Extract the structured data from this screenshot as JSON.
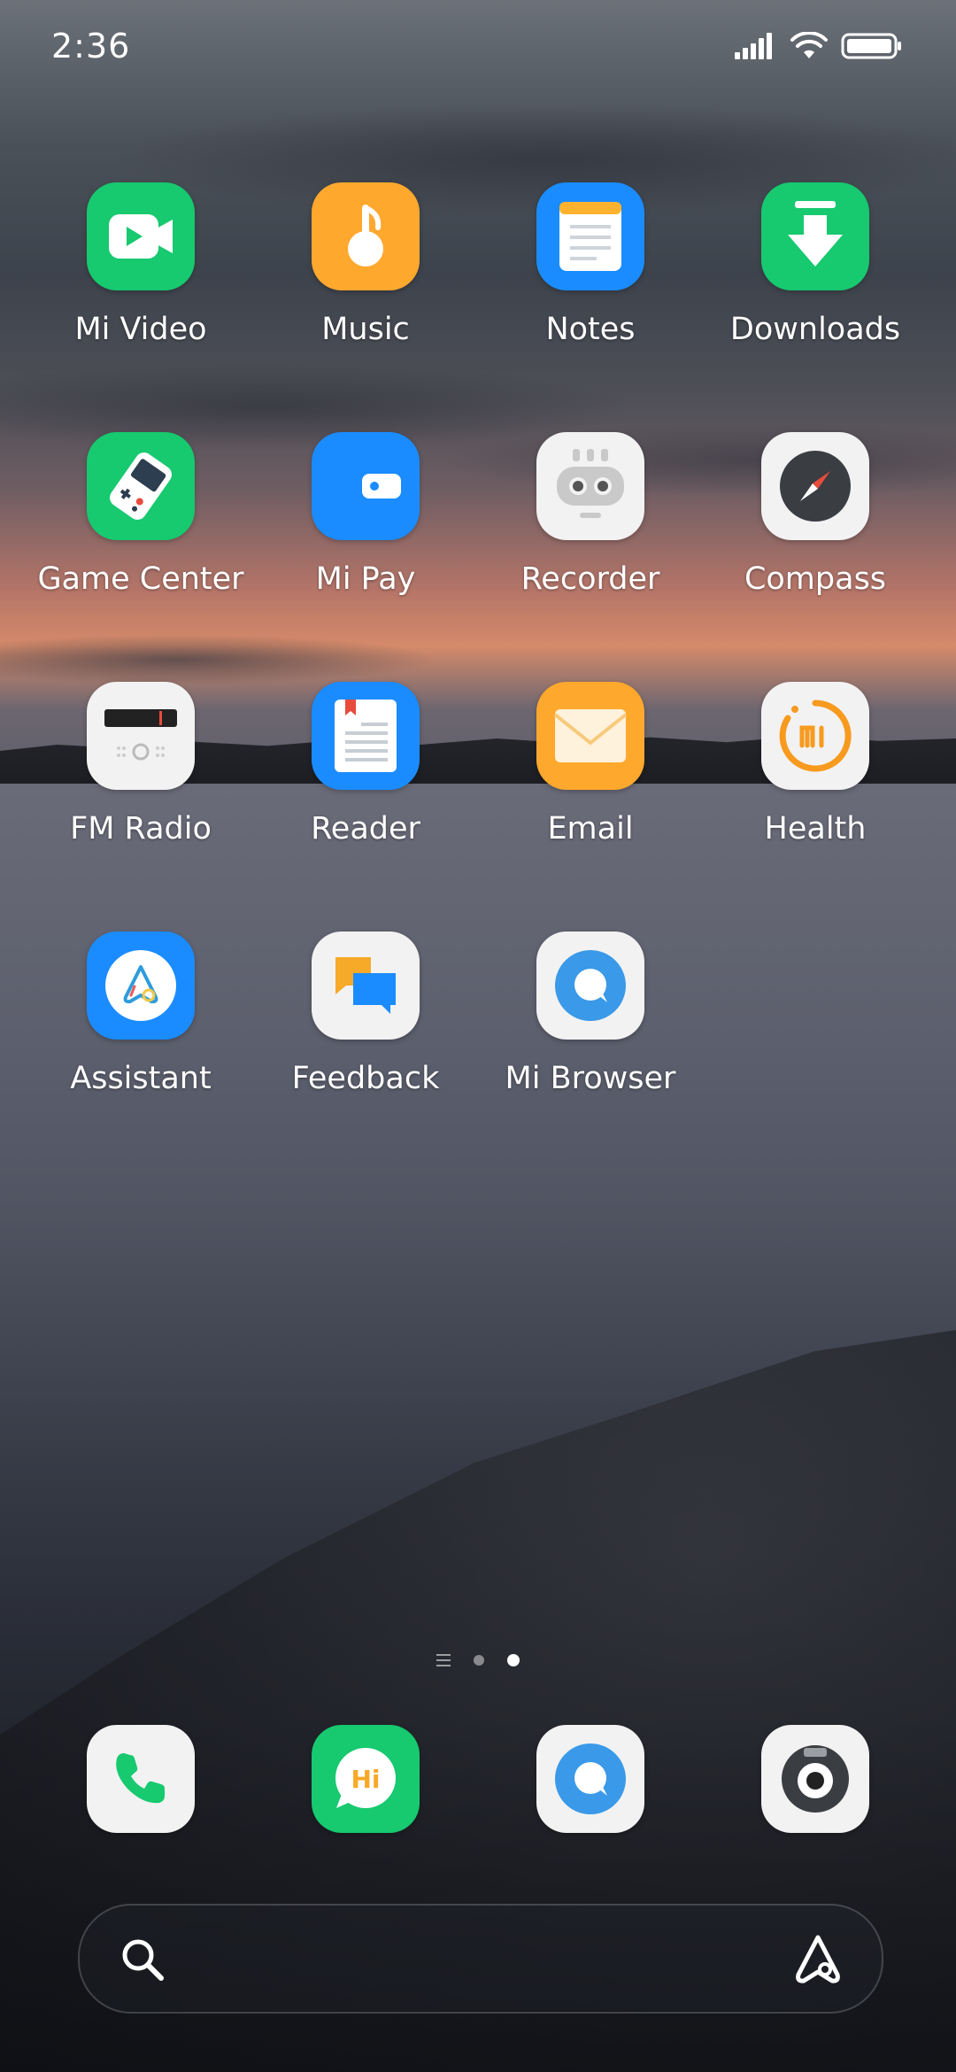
{
  "status_bar": {
    "time": "2:36",
    "icons": [
      "signal-icon",
      "wifi-icon",
      "battery-icon"
    ]
  },
  "apps": [
    {
      "label": "Mi Video",
      "icon": "mi-video-icon",
      "color": "#17c96f"
    },
    {
      "label": "Music",
      "icon": "music-icon",
      "color": "#ffa82e"
    },
    {
      "label": "Notes",
      "icon": "notes-icon",
      "color": "#1a8cff"
    },
    {
      "label": "Downloads",
      "icon": "downloads-icon",
      "color": "#17c96f"
    },
    {
      "label": "Game Center",
      "icon": "game-center-icon",
      "color": "#17c96f"
    },
    {
      "label": "Mi Pay",
      "icon": "mi-pay-icon",
      "color": "#1a8cff"
    },
    {
      "label": "Recorder",
      "icon": "recorder-icon",
      "color": "#f2f2f2"
    },
    {
      "label": "Compass",
      "icon": "compass-icon",
      "color": "#f2f2f2"
    },
    {
      "label": "FM Radio",
      "icon": "fm-radio-icon",
      "color": "#f2f2f2"
    },
    {
      "label": "Reader",
      "icon": "reader-icon",
      "color": "#1a8cff"
    },
    {
      "label": "Email",
      "icon": "email-icon",
      "color": "#ffa82e"
    },
    {
      "label": "Health",
      "icon": "health-icon",
      "color": "#f2f2f2"
    },
    {
      "label": "Assistant",
      "icon": "assistant-icon",
      "color": "#1a8cff"
    },
    {
      "label": "Feedback",
      "icon": "feedback-icon",
      "color": "#f2f2f2"
    },
    {
      "label": "Mi Browser",
      "icon": "mi-browser-icon",
      "color": "#f2f2f2"
    }
  ],
  "page_indicator": {
    "pages": 2,
    "active_page": 2
  },
  "dock": [
    {
      "icon": "phone-icon"
    },
    {
      "icon": "messaging-icon",
      "text": "Hi"
    },
    {
      "icon": "browser-icon"
    },
    {
      "icon": "camera-icon"
    }
  ],
  "search_bar": {
    "icons": [
      "search-icon",
      "assistant-icon"
    ]
  }
}
